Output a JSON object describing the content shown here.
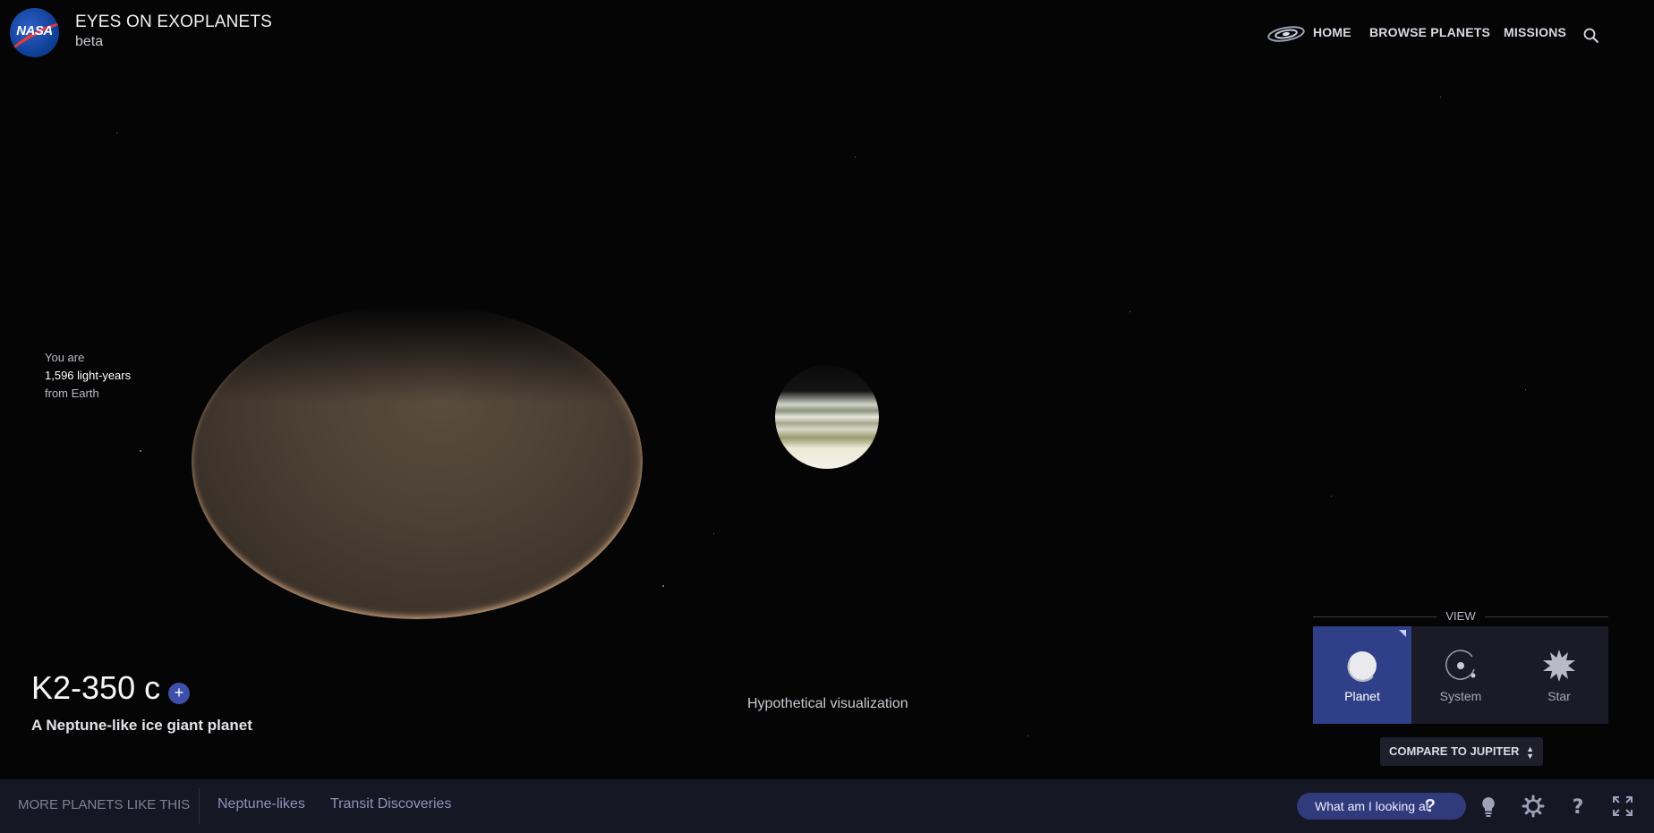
{
  "header": {
    "logo_text": "NASA",
    "title": "EYES ON EXOPLANETS",
    "subtitle": "beta",
    "nav": [
      {
        "label": "HOME",
        "icon": "galaxy-icon"
      },
      {
        "label": "BROWSE PLANETS"
      },
      {
        "label": "MISSIONS"
      }
    ],
    "search_icon": "search-icon"
  },
  "distance": {
    "prefix": "You are",
    "value": "1,596 light-years",
    "suffix": "from Earth"
  },
  "planet": {
    "name": "K2-350 c",
    "add_label": "+",
    "description": "A Neptune-like ice giant planet",
    "caption": "Hypothetical visualization"
  },
  "view": {
    "label": "VIEW",
    "options": [
      {
        "label": "Planet",
        "icon": "planet-icon",
        "selected": true
      },
      {
        "label": "System",
        "icon": "system-icon",
        "selected": false
      },
      {
        "label": "Star",
        "icon": "star-icon",
        "selected": false
      }
    ],
    "compare_label": "COMPARE TO JUPITER"
  },
  "bottom_bar": {
    "more_label": "MORE PLANETS LIKE THIS",
    "tags": [
      "Neptune-likes",
      "Transit Discoveries"
    ],
    "what_label": "What am I looking at",
    "what_icon": "question-icon",
    "icons": [
      "lightbulb-icon",
      "gear-icon",
      "help-icon",
      "fullscreen-icon"
    ]
  },
  "colors": {
    "background": "#050506",
    "accent": "#2f3f88",
    "bar": "#151725"
  }
}
